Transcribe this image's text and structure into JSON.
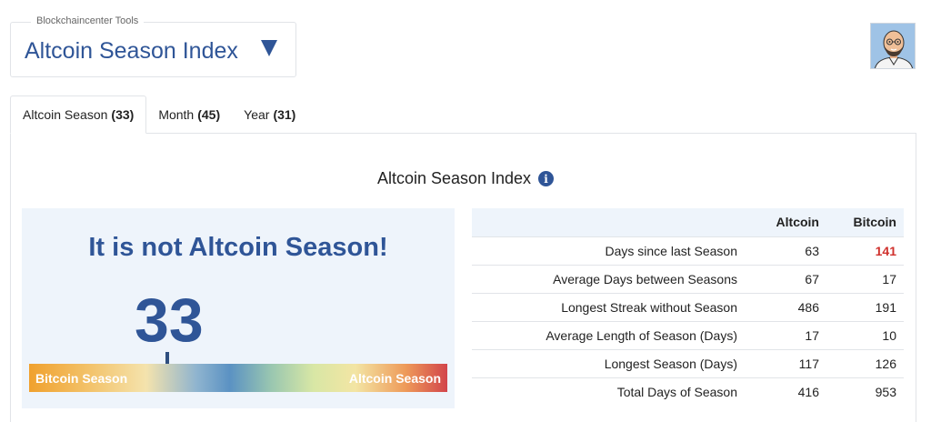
{
  "tool_selector": {
    "legend": "Blockchaincenter Tools",
    "title": "Altcoin Season Index",
    "caret_icon": "triangle-down-icon"
  },
  "avatar": {
    "icon": "user-avatar-icon"
  },
  "tabs": [
    {
      "label": "Altcoin Season",
      "value": "(33)"
    },
    {
      "label": "Month",
      "value": "(45)"
    },
    {
      "label": "Year",
      "value": "(31)"
    }
  ],
  "index_title": "Altcoin Season Index",
  "info_icon": "i",
  "gauge": {
    "message": "It is not Altcoin Season!",
    "value": "33",
    "position": 33,
    "scale_max": 100,
    "left_label": "Bitcoin Season",
    "right_label": "Altcoin Season"
  },
  "stats": {
    "headers": [
      "Altcoin",
      "Bitcoin"
    ],
    "rows": [
      {
        "label": "Days since last Season",
        "altcoin": "63",
        "bitcoin": "141"
      },
      {
        "label": "Average Days between Seasons",
        "altcoin": "67",
        "bitcoin": "17"
      },
      {
        "label": "Longest Streak without Season",
        "altcoin": "486",
        "bitcoin": "191"
      },
      {
        "label": "Average Length of Season (Days)",
        "altcoin": "17",
        "bitcoin": "10"
      },
      {
        "label": "Longest Season (Days)",
        "altcoin": "117",
        "bitcoin": "126"
      },
      {
        "label": "Total Days of Season",
        "altcoin": "416",
        "bitcoin": "953"
      }
    ]
  },
  "colors": {
    "accent": "#2f5597",
    "highlight": "#d0312d",
    "panel_bg": "#eef4fb"
  }
}
